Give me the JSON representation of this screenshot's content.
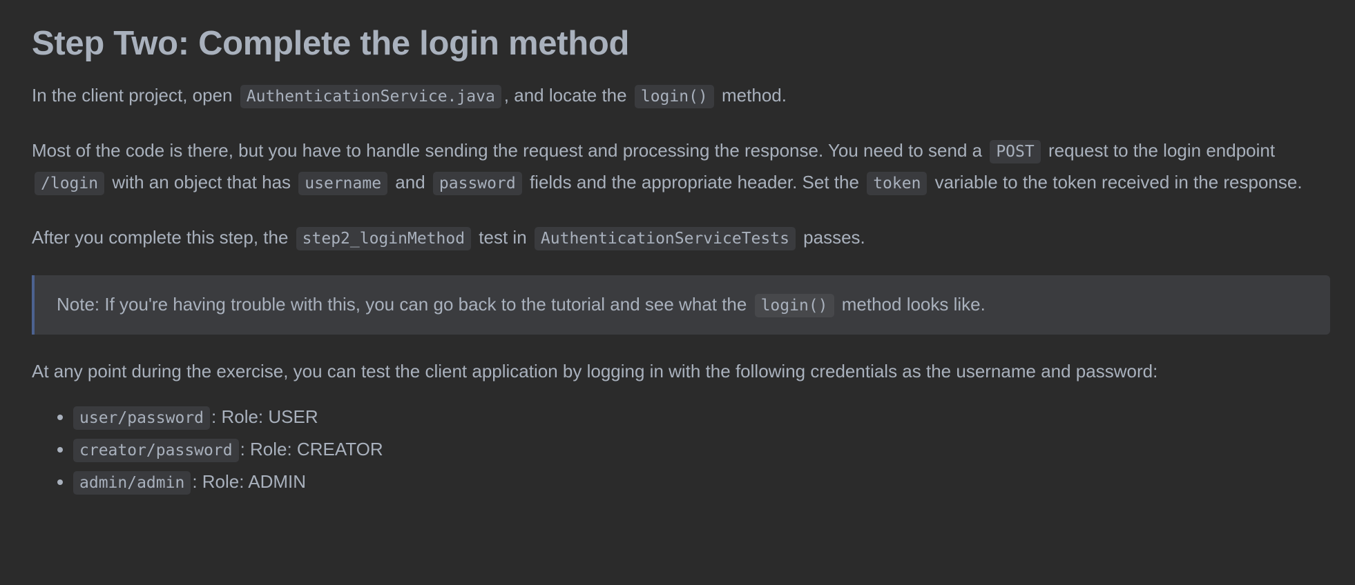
{
  "title": "Step Two: Complete the login method",
  "p1": {
    "t1": "In the client project, open",
    "c1": "AuthenticationService.java",
    "t2": ", and locate the",
    "c2": "login()",
    "t3": "method."
  },
  "p2": {
    "t1": "Most of the code is there, but you have to handle sending the request and processing the response. You need to send a",
    "c1": "POST",
    "t2": "request to the login endpoint",
    "c2": "/login",
    "t3": "with an object that has",
    "c3": "username",
    "t4": "and",
    "c4": "password",
    "t5": "fields and the appropriate header. Set the",
    "c5": "token",
    "t6": "variable to the token received in the response."
  },
  "p3": {
    "t1": "After you complete this step, the",
    "c1": "step2_loginMethod",
    "t2": "test in",
    "c2": "AuthenticationServiceTests",
    "t3": "passes."
  },
  "note": {
    "t1": "Note: If you're having trouble with this, you can go back to the tutorial and see what the",
    "c1": "login()",
    "t2": "method looks like."
  },
  "p4": "At any point during the exercise, you can test the client application by logging in with the following credentials as the username and password:",
  "credentials": [
    {
      "code": "user/password",
      "role": ": Role: USER"
    },
    {
      "code": "creator/password",
      "role": ": Role: CREATOR"
    },
    {
      "code": "admin/admin",
      "role": ": Role: ADMIN"
    }
  ],
  "colors": {
    "background": "#2b2b2b",
    "text": "#a9b1bd",
    "code_bg": "#3a3b3e",
    "note_bg": "#3b3c3f",
    "note_border": "#4c6290"
  }
}
